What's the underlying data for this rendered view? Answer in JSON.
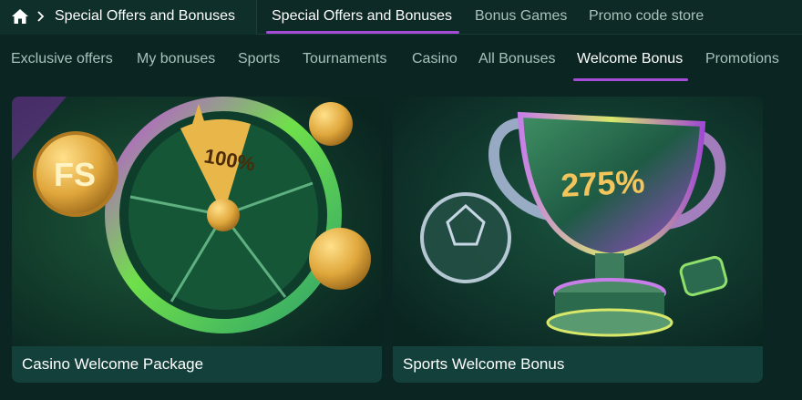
{
  "breadcrumb": {
    "home_icon": "home-icon",
    "separator_icon": "chevron-right-icon",
    "current": "Special Offers and Bonuses"
  },
  "top_tabs": [
    {
      "label": "Special Offers and Bonuses",
      "active": true
    },
    {
      "label": "Bonus Games",
      "active": false
    },
    {
      "label": "Promo code store",
      "active": false
    }
  ],
  "sub_tabs": [
    {
      "label": "Exclusive offers",
      "active": false
    },
    {
      "label": "My bonuses",
      "active": false
    },
    {
      "label": "Sports",
      "active": false
    },
    {
      "label": "Tournaments",
      "active": false
    },
    {
      "label": "Casino",
      "active": false
    },
    {
      "label": "All Bonuses",
      "active": false
    },
    {
      "label": "Welcome Bonus",
      "active": true
    },
    {
      "label": "Promotions",
      "active": false
    }
  ],
  "cards": [
    {
      "title": "Casino Welcome Package",
      "art": {
        "wheel_segment_text": "100%",
        "coin_text": "FS"
      }
    },
    {
      "title": "Sports Welcome Bonus",
      "art": {
        "trophy_text": "275%"
      }
    }
  ],
  "colors": {
    "background": "#0b2622",
    "active_underline": "#a64bd8",
    "card_footer": "#13403a",
    "gold": "#e9b64a"
  }
}
